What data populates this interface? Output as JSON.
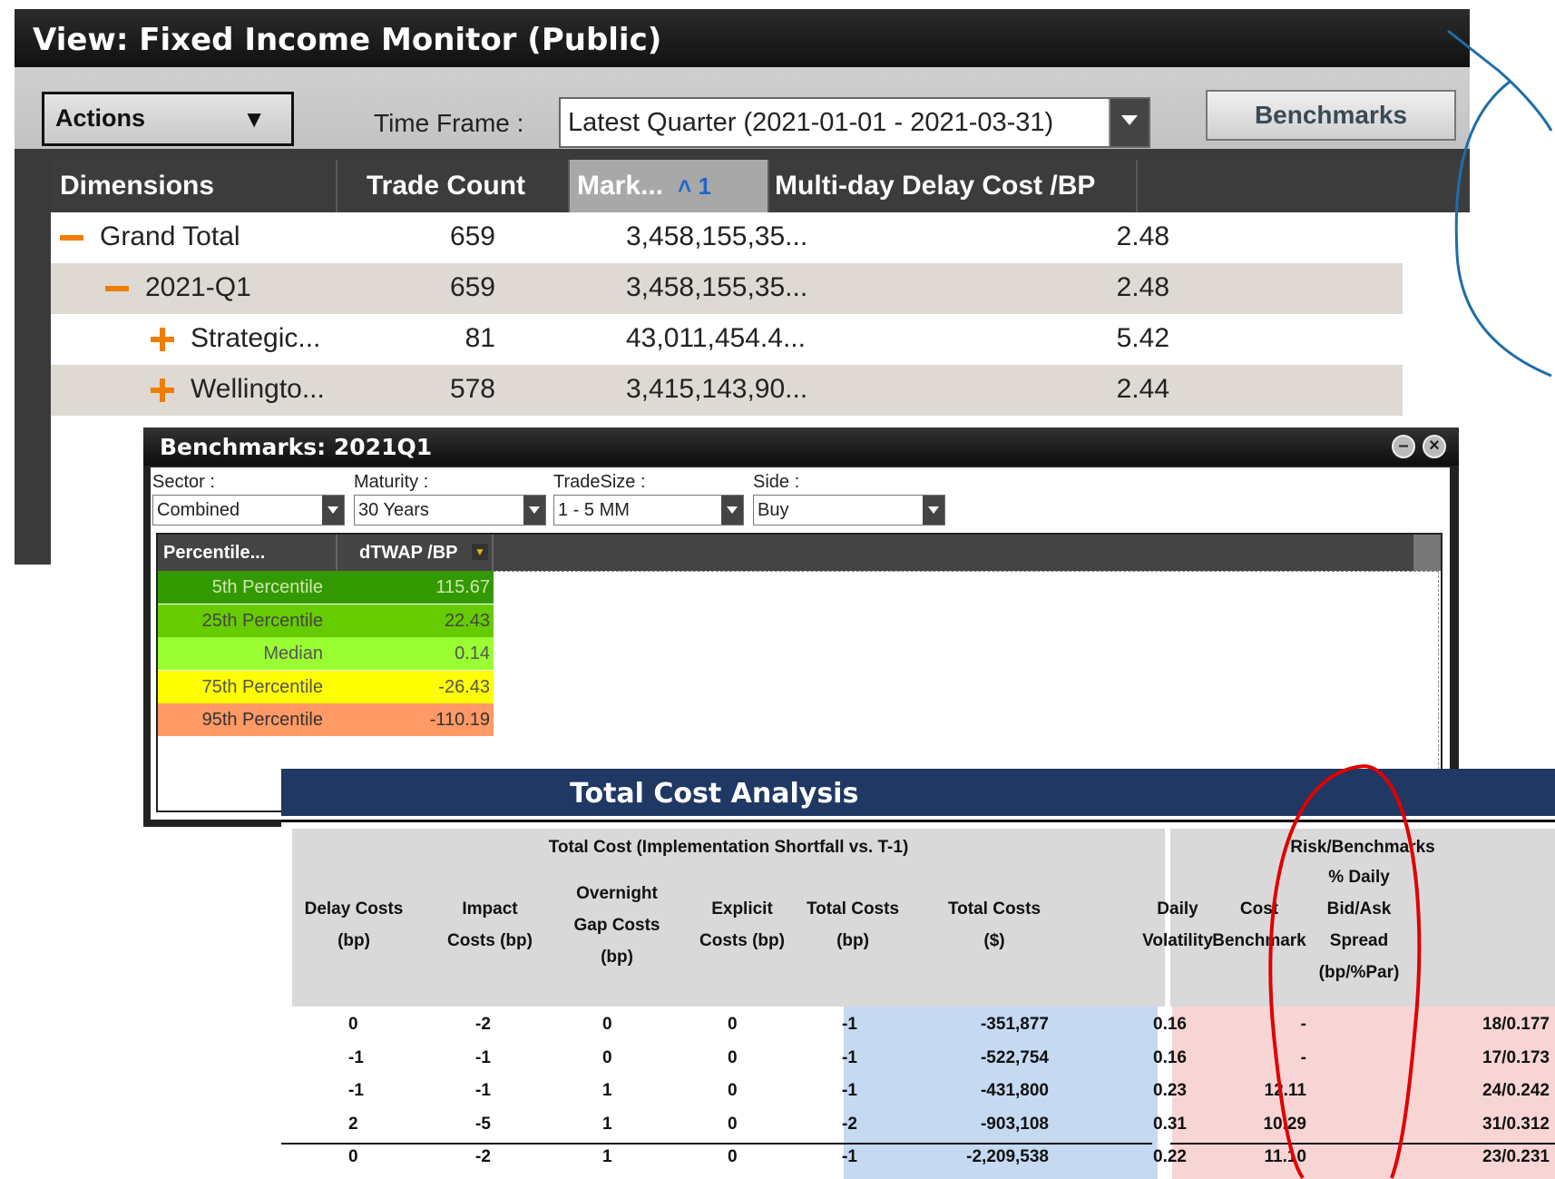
{
  "monitor": {
    "title": "View: Fixed Income Monitor (Public)",
    "actions_label": "Actions",
    "timeframe_label": "Time Frame :",
    "timeframe_value": "Latest Quarter (2021-01-01 - 2021-03-31)",
    "benchmarks_label": "Benchmarks",
    "columns": [
      "Dimensions",
      "Trade Count",
      "Mark...",
      "Multi-day Delay Cost /BP"
    ],
    "sort_indicator": "1",
    "rows": [
      {
        "label": "Grand Total",
        "count": "659",
        "mark": "3,458,155,35...",
        "delay": "2.48"
      },
      {
        "label": "2021-Q1",
        "count": "659",
        "mark": "3,458,155,35...",
        "delay": "2.48"
      },
      {
        "label": "Strategic...",
        "count": "81",
        "mark": "43,011,454.4...",
        "delay": "5.42"
      },
      {
        "label": "Wellingto...",
        "count": "578",
        "mark": "3,415,143,90...",
        "delay": "2.44"
      }
    ]
  },
  "benchmarks": {
    "title": "Benchmarks: 2021Q1",
    "filters": [
      {
        "label": "Sector :",
        "value": "Combined"
      },
      {
        "label": "Maturity :",
        "value": "30 Years"
      },
      {
        "label": "TradeSize :",
        "value": "1 - 5 MM"
      },
      {
        "label": "Side :",
        "value": "Buy"
      }
    ],
    "col_percentile": "Percentile...",
    "col_dtwap": "dTWAP /BP",
    "rows": [
      {
        "label": "5th Percentile",
        "value": "115.67",
        "color": "#339900"
      },
      {
        "label": "25th Percentile",
        "value": "22.43",
        "color": "#66cc00"
      },
      {
        "label": "Median",
        "value": "0.14",
        "color": "#99ff33"
      },
      {
        "label": "75th Percentile",
        "value": "-26.43",
        "color": "#ffff00"
      },
      {
        "label": "95th Percentile",
        "value": "-110.19",
        "color": "#ff9966"
      }
    ]
  },
  "tca": {
    "title": "Total Cost Analysis",
    "group_left": "Total Cost (Implementation Shortfall vs. T-1)",
    "group_right": "Risk/Benchmarks",
    "headers": [
      [
        "Delay Costs",
        "(bp)"
      ],
      [
        "Impact",
        "Costs (bp)"
      ],
      [
        "Overnight",
        "Gap Costs",
        "(bp)"
      ],
      [
        "Explicit",
        "Costs (bp)"
      ],
      [
        "Total Costs",
        "(bp)"
      ],
      [
        "Total Costs",
        "($)"
      ],
      [
        "Daily",
        "Volatility"
      ],
      [
        "Cost",
        "Benchmark"
      ],
      [
        "% Daily",
        "Bid/Ask",
        "Spread",
        "(bp/%Par)"
      ]
    ],
    "rows": [
      [
        "0",
        "-2",
        "0",
        "0",
        "-1",
        "-351,877",
        "0.16",
        "-",
        "18/0.177"
      ],
      [
        "-1",
        "-1",
        "0",
        "0",
        "-1",
        "-522,754",
        "0.16",
        "-",
        "17/0.173"
      ],
      [
        "-1",
        "-1",
        "1",
        "0",
        "-1",
        "-431,800",
        "0.23",
        "12.11",
        "24/0.242"
      ],
      [
        "2",
        "-5",
        "1",
        "0",
        "-2",
        "-903,108",
        "0.31",
        "10.29",
        "31/0.312"
      ],
      [
        "0",
        "-2",
        "1",
        "0",
        "-1",
        "-2,209,538",
        "0.22",
        "11.10",
        "23/0.231"
      ]
    ]
  },
  "colors": {
    "accent_orange": "#ef7d00",
    "tca_header_navy": "#1f3864",
    "total_cost_highlight": "#c5d9f1",
    "risk_highlight": "#f8d5d5",
    "annotation_red": "#e00000",
    "annotation_blue": "#1f6ea8"
  }
}
